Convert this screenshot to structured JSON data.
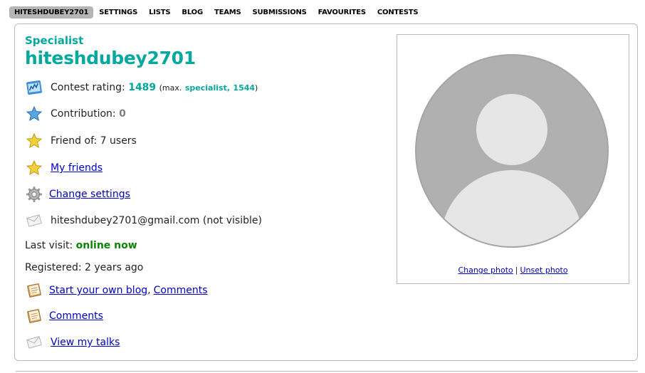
{
  "nav": {
    "items": [
      "HITESHDUBEY2701",
      "SETTINGS",
      "LISTS",
      "BLOG",
      "TEAMS",
      "SUBMISSIONS",
      "FAVOURITES",
      "CONTESTS"
    ]
  },
  "profile": {
    "rank": "Specialist",
    "handle": "hiteshdubey2701",
    "rank_color": "#03a89e",
    "rating_label": "Contest rating:",
    "rating_value": "1489",
    "max_prefix": "(max.",
    "max_rank": "specialist,",
    "max_rating": "1544",
    "max_suffix": ")",
    "contribution_label": "Contribution:",
    "contribution_value": "0",
    "friend_of": "Friend of: 7 users",
    "my_friends": "My friends",
    "change_settings": "Change settings",
    "email": "hiteshdubey2701@gmail.com (not visible)",
    "last_visit_label": "Last visit:",
    "last_visit_value": "online now",
    "registered": "Registered: 2 years ago",
    "blog_link": "Start your own blog",
    "blog_comma": ",",
    "blog_comments": "Comments",
    "comments": "Comments",
    "talks": "View my talks"
  },
  "photo": {
    "change": "Change photo",
    "separator": "|",
    "unset": "Unset photo"
  },
  "icons": {
    "rating": "rating-chart-icon",
    "contribution": "blue-star-icon",
    "friend_of": "gold-star-icon",
    "my_friends": "gold-star-icon",
    "settings": "gear-icon",
    "email": "envelope-icon",
    "blog": "notebook-icon",
    "comments": "notebook-icon",
    "talks": "envelope-icon"
  }
}
